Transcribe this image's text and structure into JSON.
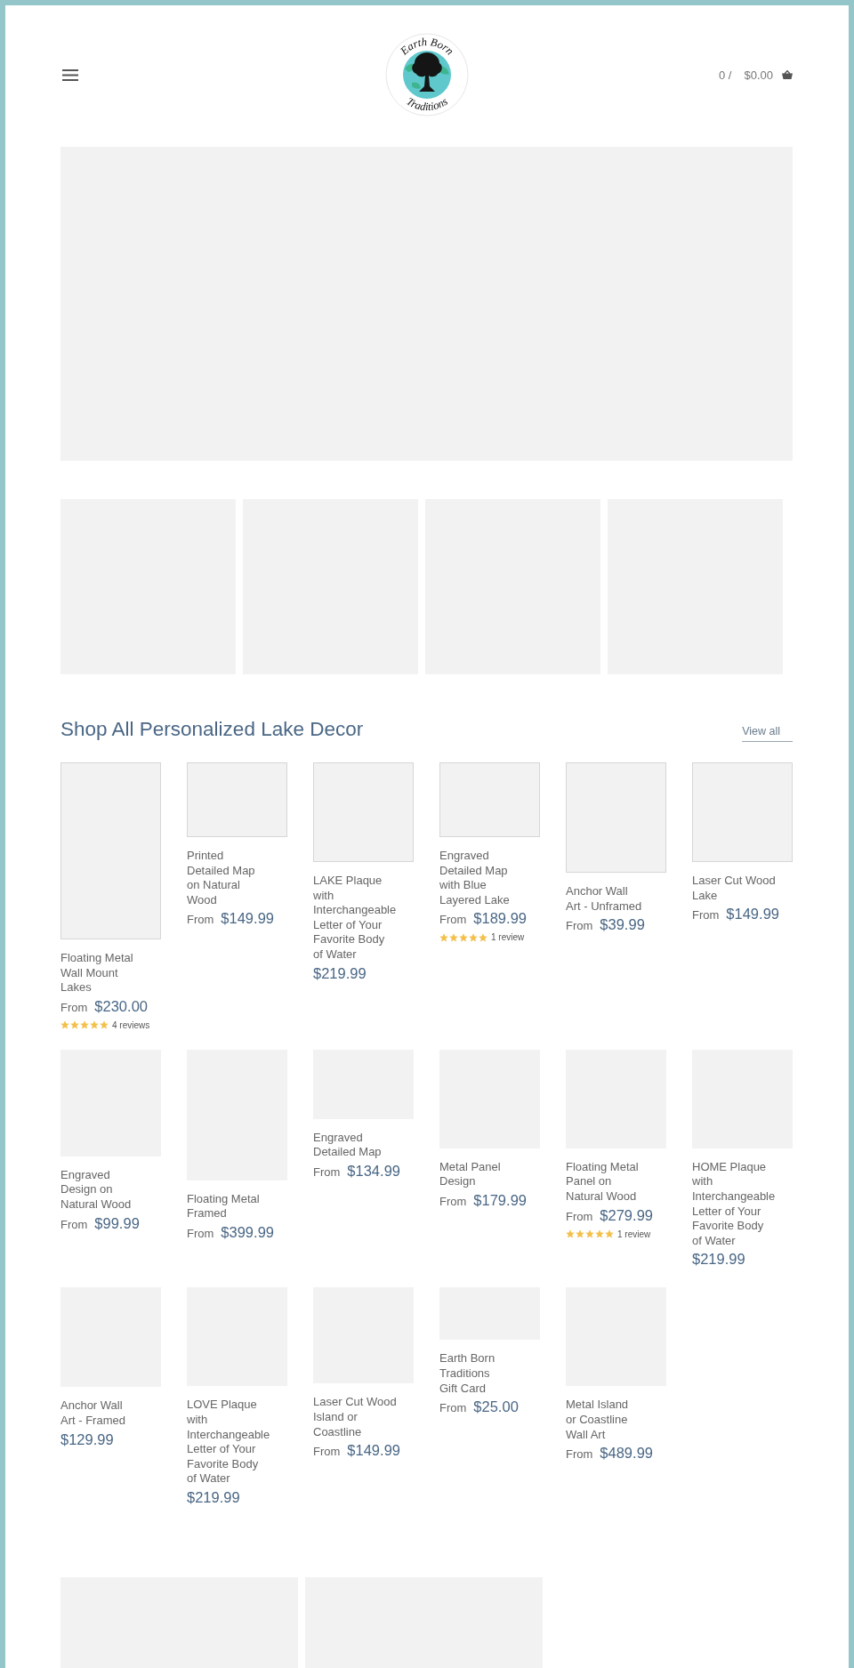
{
  "header": {
    "logo": {
      "top_text": "Earth Born",
      "bottom_text": "Traditions"
    },
    "cart": {
      "count": "0 /",
      "total": "$0.00"
    }
  },
  "collection": {
    "title": "Shop All Personalized Lake Decor",
    "view_all": "View all",
    "products": [
      {
        "name": "Floating Metal\nWall Mount\nLakes",
        "from": "From",
        "price": "$230.00",
        "rating": {
          "stars": 5,
          "reviews": "4 reviews"
        }
      },
      {
        "name": "Printed\nDetailed Map\non Natural\nWood",
        "from": "From",
        "price": "$149.99"
      },
      {
        "name": "LAKE Plaque\nwith\nInterchangeable\nLetter of Your\nFavorite Body\nof Water",
        "price": "$219.99"
      },
      {
        "name": "Engraved\nDetailed Map\nwith Blue\nLayered Lake",
        "from": "From",
        "price": "$189.99",
        "rating": {
          "stars": 5,
          "reviews": "1 review"
        }
      },
      {
        "name": "Anchor Wall\nArt - Unframed",
        "from": "From",
        "price": "$39.99"
      },
      {
        "name": "Laser Cut Wood\nLake",
        "from": "From",
        "price": "$149.99"
      },
      {
        "name": "Engraved\nDesign on\nNatural Wood",
        "from": "From",
        "price": "$99.99"
      },
      {
        "name": "Floating Metal\nFramed",
        "from": "From",
        "price": "$399.99"
      },
      {
        "name": "Engraved\nDetailed Map",
        "from": "From",
        "price": "$134.99"
      },
      {
        "name": "Metal Panel\nDesign",
        "from": "From",
        "price": "$179.99"
      },
      {
        "name": "Floating Metal\nPanel on\nNatural Wood",
        "from": "From",
        "price": "$279.99",
        "rating": {
          "stars": 5,
          "reviews": "1 review"
        }
      },
      {
        "name": "HOME Plaque\nwith\nInterchangeable\nLetter of Your\nFavorite Body\nof Water",
        "price": "$219.99"
      },
      {
        "name": "Anchor Wall\nArt - Framed",
        "price": "$129.99"
      },
      {
        "name": "LOVE Plaque\nwith\nInterchangeable\nLetter of Your\nFavorite Body\nof Water",
        "price": "$219.99"
      },
      {
        "name": "Laser Cut Wood\nIsland or\nCoastline",
        "from": "From",
        "price": "$149.99"
      },
      {
        "name": "Earth Born\nTraditions\nGift Card",
        "from": "From",
        "price": "$25.00"
      },
      {
        "name": "Metal Island\nor Coastline\nWall Art",
        "from": "From",
        "price": "$489.99"
      }
    ]
  }
}
